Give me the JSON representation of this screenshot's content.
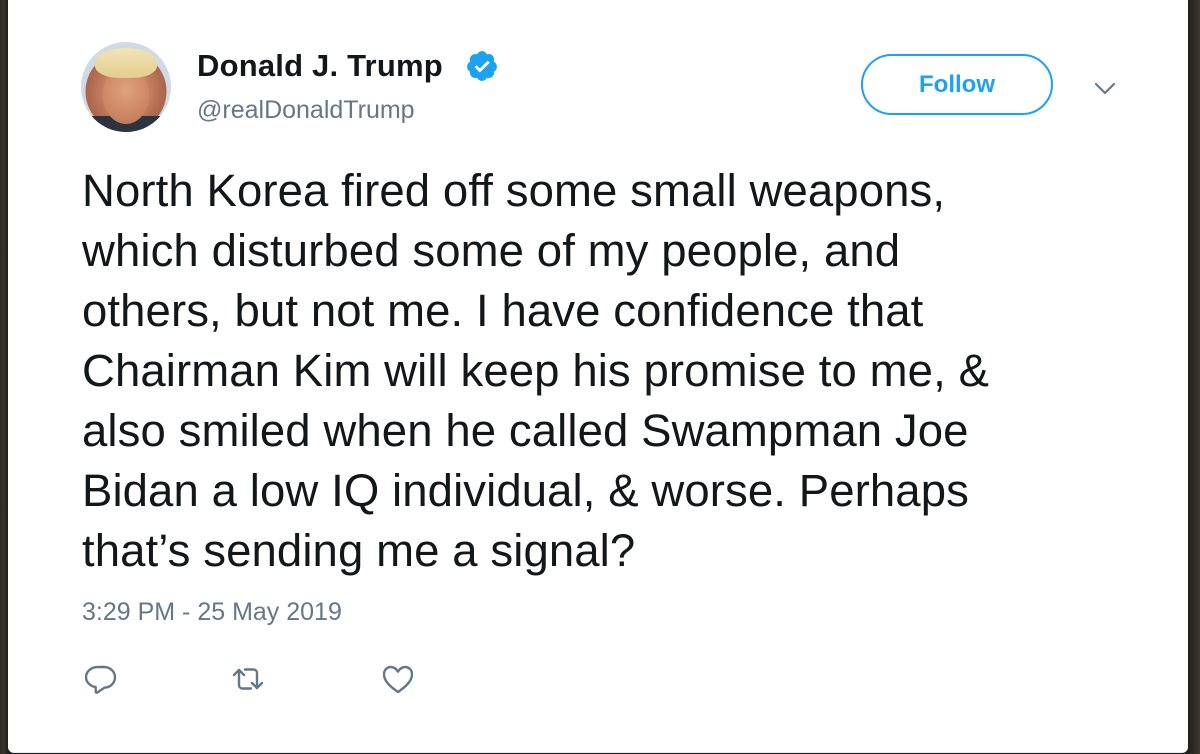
{
  "tweet": {
    "author": {
      "display_name": "Donald J. Trump",
      "handle": "@realDonaldTrump",
      "verified": true
    },
    "follow_label": "Follow",
    "text": "North Korea fired off some small weapons,\nwhich disturbed some of my people, and\nothers, but not me. I have confidence that\nChairman Kim will keep his promise to me, &\nalso smiled when he called Swampman Joe\nBidan a low IQ individual, & worse. Perhaps\nthat’s sending me a signal?",
    "timestamp": "3:29 PM - 25 May 2019",
    "actions": [
      {
        "icon": "reply-icon"
      },
      {
        "icon": "retweet-icon"
      },
      {
        "icon": "like-icon"
      }
    ]
  },
  "colors": {
    "accent": "#1da1f2",
    "text_primary": "#14171a",
    "text_secondary": "#657786"
  }
}
